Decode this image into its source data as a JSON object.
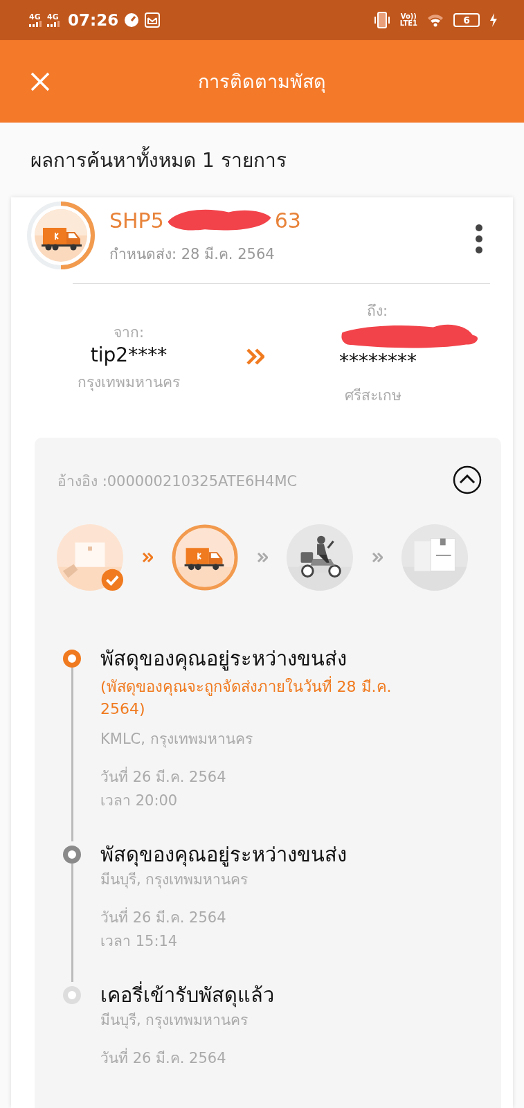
{
  "status_bar": {
    "networks": [
      "4G",
      "4G"
    ],
    "time": "07:26",
    "volte": {
      "top": "Vo))",
      "bottom": "LTE1"
    },
    "battery": "6"
  },
  "header": {
    "title": "การติดตามพัสดุ"
  },
  "result_summary": "ผลการค้นหาทั้งหมด 1 รายการ",
  "parcel": {
    "tracking_start": "SHP5",
    "tracking_end": "63",
    "due": "กำหนดส่ง: 28 มี.ค. 2564",
    "from": {
      "label": "จาก:",
      "name": "tip2****",
      "city": "กรุงเทพมหานคร"
    },
    "to": {
      "label": "ถึง:",
      "name": "********",
      "city": "ศรีสะเกษ"
    },
    "reference": "อ้างอิง :000000210325ATE6H4MC",
    "expanded": true,
    "stages": [
      {
        "kind": "pickup",
        "completed": true,
        "selected": false
      },
      {
        "kind": "truck",
        "completed": false,
        "selected": true
      },
      {
        "kind": "rider",
        "completed": false,
        "selected": false
      },
      {
        "kind": "box",
        "completed": false,
        "selected": false
      }
    ],
    "events": [
      {
        "kind": "current",
        "title": "พัสดุของคุณอยู่ระหว่างขนส่ง",
        "note": "(พัสดุของคุณจะถูกจัดส่งภายในวันที่ 28 มี.ค. 2564)",
        "location": "KMLC, กรุงเทพมหานคร",
        "date": "วันที่ 26 มี.ค. 2564",
        "time": "เวลา 20:00"
      },
      {
        "kind": "past",
        "title": "พัสดุของคุณอยู่ระหว่างขนส่ง",
        "location": "มีนบุรี, กรุงเทพมหานคร",
        "date": "วันที่ 26 มี.ค. 2564",
        "time": "เวลา 15:14"
      },
      {
        "kind": "first",
        "title": "เคอรี่เข้ารับพัสดุแล้ว",
        "location": "มีนบุรี, กรุงเทพมหานคร",
        "date": "วันที่ 26 มี.ค. 2564"
      }
    ]
  }
}
